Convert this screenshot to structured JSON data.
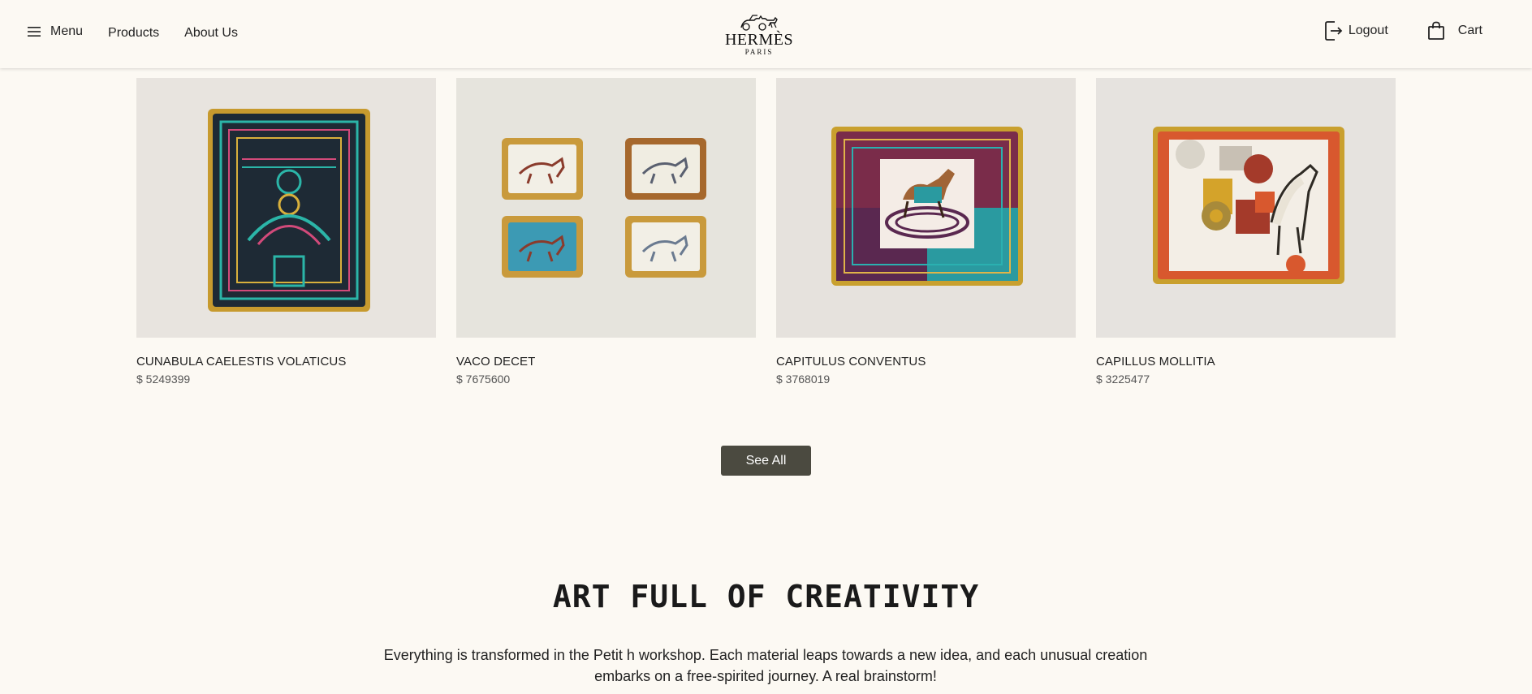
{
  "header": {
    "menu_label": "Menu",
    "nav_links": [
      "Products",
      "About Us"
    ],
    "brand": "HERMÈS",
    "brand_sub": "PARIS",
    "logout_label": "Logout",
    "cart_label": "Cart"
  },
  "products": [
    {
      "name": "CUNABULA CAELESTIS VOLATICUS",
      "price": "$ 5249399"
    },
    {
      "name": "VACO DECET",
      "price": "$ 7675600"
    },
    {
      "name": "CAPITULUS CONVENTUS",
      "price": "$ 3768019"
    },
    {
      "name": "CAPILLUS MOLLITIA",
      "price": "$ 3225477"
    }
  ],
  "see_all_label": "See All",
  "section": {
    "title": "ART FULL OF CREATIVITY",
    "text": "Everything is transformed in the Petit h workshop. Each material leaps towards a new idea, and each unusual creation embarks on a free-spirited journey. A real brainstorm!"
  },
  "colors": {
    "background": "#fcf9f3",
    "button": "#4b4a40",
    "text": "#1f1f1f"
  },
  "icons": [
    "hamburger-menu-icon",
    "logout-icon",
    "shopping-bag-icon",
    "hermes-carriage-logo"
  ]
}
